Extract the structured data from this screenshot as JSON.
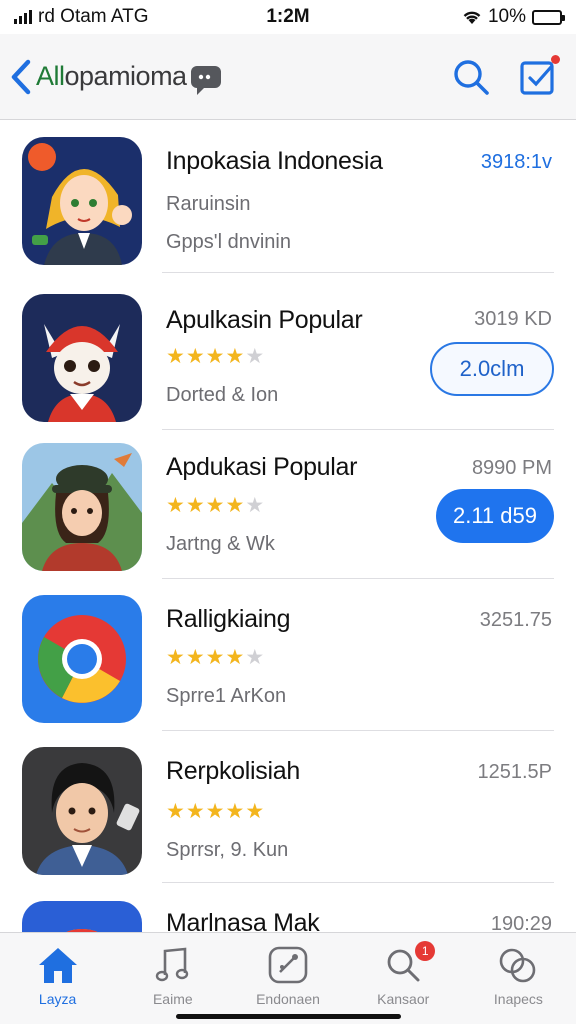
{
  "status_bar": {
    "carrier": "rd Otam ATG",
    "time": "1:2M",
    "battery_text": "10%",
    "battery_level": 0.1
  },
  "nav": {
    "title_accent": "All",
    "title_rest": "opamioma",
    "icons": [
      "back-chevron-icon",
      "chat-bubble-icon",
      "search-icon",
      "compose-icon"
    ]
  },
  "apps": [
    {
      "name": "Inpokasia Indonesia",
      "line1": "Raruinsin",
      "line2": "Gpps'l dnvinin",
      "size": "3918:1v",
      "size_color": "#1f6fe0",
      "rating": null,
      "button": null,
      "icon": "anime-girl-icon"
    },
    {
      "name": "Apulkasin Popular",
      "line1": null,
      "line2": "Dorted & Ion",
      "size": "3019 KD",
      "rating": 4,
      "button": {
        "label": "2.0clm",
        "style": "outline"
      },
      "icon": "fox-character-icon"
    },
    {
      "name": "Apdukasi Popular",
      "line1": null,
      "line2": "Jartng & Wk",
      "size": "8990 PM",
      "rating": 4,
      "button": {
        "label": "2.11 d59",
        "style": "solid"
      },
      "icon": "girl-hat-icon"
    },
    {
      "name": "Ralligkiaing",
      "line1": null,
      "line2": "Sprre1 ArKon",
      "size": "3251.75",
      "rating": 4,
      "button": null,
      "icon": "chrome-icon"
    },
    {
      "name": "Rerpkolisiah",
      "line1": null,
      "line2": "Sprrsr, 9. Kun",
      "size": "1251.5P",
      "rating": 4.5,
      "button": null,
      "icon": "boy-portrait-icon"
    },
    {
      "name": "Marlnasa Mak",
      "line1": null,
      "line2": null,
      "size": "190:29",
      "rating": null,
      "button": null,
      "icon": "colorful-app-icon"
    }
  ],
  "tabs": [
    {
      "label": "Layza",
      "icon": "home-icon",
      "active": true
    },
    {
      "label": "Eaime",
      "icon": "music-icon",
      "active": false
    },
    {
      "label": "Endonaen",
      "icon": "explore-icon",
      "active": false
    },
    {
      "label": "Kansaor",
      "icon": "search-icon",
      "active": false,
      "badge": "1"
    },
    {
      "label": "Inapecs",
      "icon": "circles-icon",
      "active": false
    }
  ],
  "colors": {
    "accent": "#1f6fe0",
    "star": "#f3b51d",
    "badge": "#e53935",
    "title_green": "#1f7a36"
  }
}
